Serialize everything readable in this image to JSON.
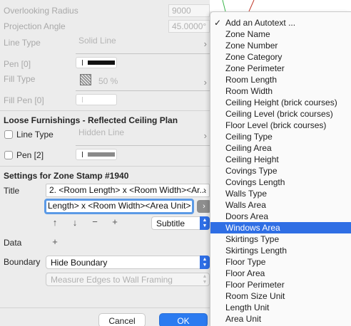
{
  "settings": {
    "overlooking_radius": {
      "label": "Overlooking Radius",
      "value": "9000"
    },
    "projection_angle": {
      "label": "Projection Angle",
      "value": "45.0000°"
    },
    "line_type": {
      "label": "Line Type",
      "value": "Solid Line"
    },
    "pen": {
      "label": "Pen [0]"
    },
    "fill_type": {
      "label": "Fill Type",
      "value": "50 %"
    },
    "fill_pen": {
      "label": "Fill Pen [0]"
    }
  },
  "loose": {
    "section_title": "Loose Furnishings - Reflected Ceiling Plan",
    "line_type": {
      "label": "Line Type",
      "value": "Hidden Line"
    },
    "pen": {
      "label": "Pen [2]"
    }
  },
  "zone_stamp": {
    "section_title": "Settings for Zone Stamp #1940",
    "title_label": "Title",
    "title_value": "2. <Room Length> x <Room Width><Ar...",
    "title_edit": "Length> x <Room Width><Area Unit>",
    "subtitle_select": "Subtitle",
    "data_label": "Data",
    "boundary_label": "Boundary",
    "boundary_value": "Hide Boundary",
    "measure_value": "Measure Edges to Wall Framing"
  },
  "buttons": {
    "cancel": "Cancel",
    "ok": "OK"
  },
  "menu": {
    "items": [
      "Add an Autotext ...",
      "Zone Name",
      "Zone Number",
      "Zone Category",
      "Zone Perimeter",
      "Room Length",
      "Room Width",
      "Ceiling Height (brick courses)",
      "Ceiling Level (brick courses)",
      "Floor Level (brick courses)",
      "Ceiling Type",
      "Ceiling Area",
      "Ceiling Height",
      "Covings Type",
      "Covings Length",
      "Walls Type",
      "Walls Area",
      "Doors Area",
      "Windows Area",
      "Skirtings Type",
      "Skirtings Length",
      "Floor Type",
      "Floor Area",
      "Floor Perimeter",
      "Room Size Unit",
      "Length Unit",
      "Area Unit"
    ],
    "checked_index": 0,
    "highlighted_index": 18
  },
  "colors": {
    "accent": "#2f6ee4",
    "ok_button": "#2b7bf0",
    "focus_ring": "#5b9ae6"
  }
}
